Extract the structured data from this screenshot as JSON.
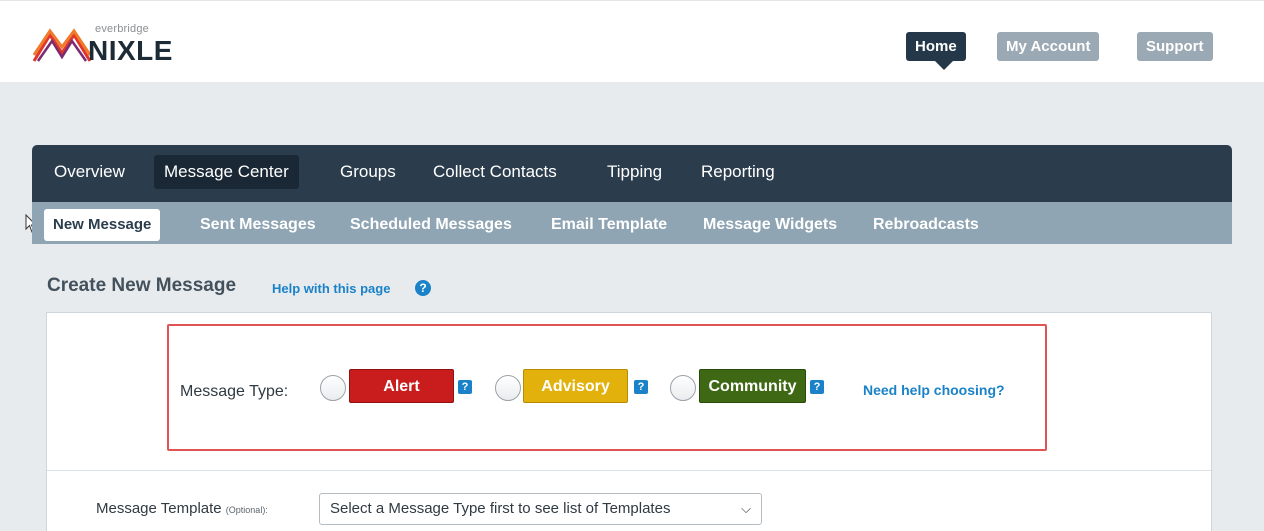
{
  "brand": {
    "small_text": "everbridge",
    "name": "NIXLE"
  },
  "top_nav": {
    "home": "Home",
    "my_account": "My Account",
    "support": "Support"
  },
  "main_nav": {
    "items": [
      "Overview",
      "Message Center",
      "Groups",
      "Collect Contacts",
      "Tipping",
      "Reporting"
    ],
    "active": "Message Center"
  },
  "sub_nav": {
    "items": [
      "New Message",
      "Sent Messages",
      "Scheduled Messages",
      "Email Template",
      "Message Widgets",
      "Rebroadcasts"
    ],
    "active": "New Message"
  },
  "page": {
    "title": "Create New Message",
    "help_link": "Help with this page",
    "help_icon": "?"
  },
  "message_type": {
    "label": "Message Type:",
    "options": [
      {
        "label": "Alert",
        "color": "#c91c1c"
      },
      {
        "label": "Advisory",
        "color": "#e3b10c"
      },
      {
        "label": "Community",
        "color": "#3e6814"
      }
    ],
    "help_badge": "?",
    "need_help": "Need help choosing?"
  },
  "message_template": {
    "label": "Message Template",
    "optional": "(Optional):",
    "select_value": "Select a Message Type first to see list of Templates"
  },
  "colors": {
    "nav_dark": "#2b3d4d",
    "sub_nav": "#8fa5b4",
    "link_blue": "#1a82c8",
    "highlight_red": "#e05454"
  }
}
